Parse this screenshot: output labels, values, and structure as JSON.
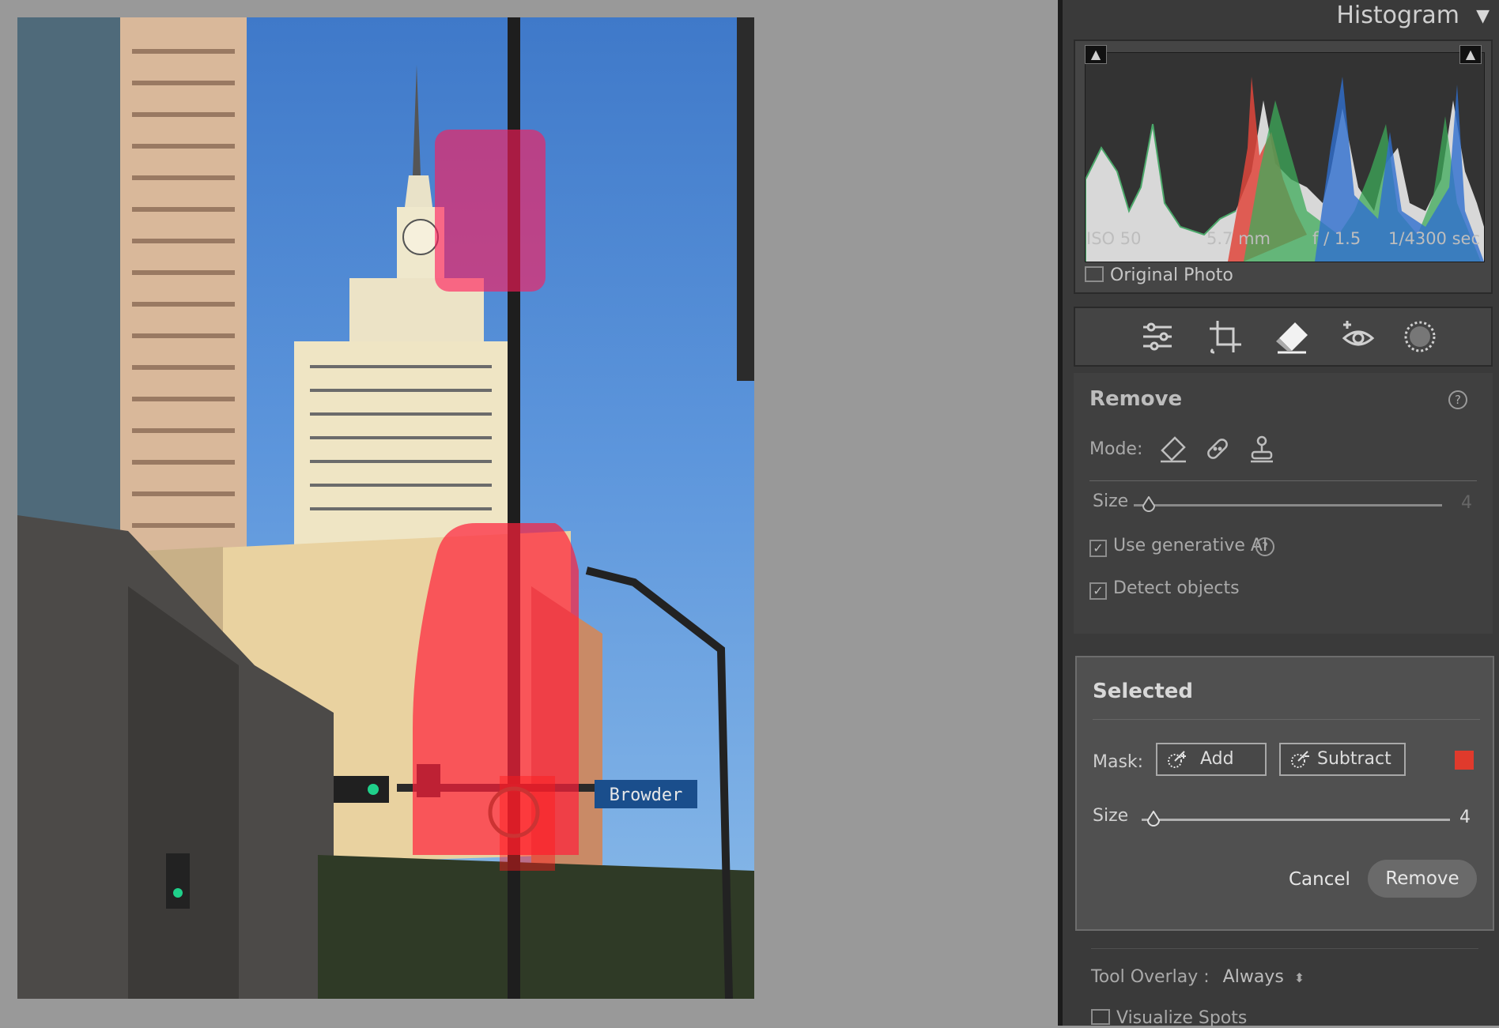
{
  "histogram": {
    "title": "Histogram",
    "menu_icon": "triangle-down-icon",
    "iso": "ISO 50",
    "focal": "5.7 mm",
    "aperture": "f / 1.5",
    "shutter": "1/4300 sec",
    "original_photo_label": "Original Photo"
  },
  "tools": [
    "edit-sliders-icon",
    "crop-icon",
    "eraser-icon",
    "red-eye-icon",
    "masking-icon"
  ],
  "remove_panel": {
    "title": "Remove",
    "mode_label": "Mode:",
    "size_label": "Size",
    "size_value": "4",
    "generative_ai_label": "Use generative AI",
    "generative_ai_checked": true,
    "detect_objects_label": "Detect objects",
    "detect_objects_checked": true
  },
  "selected_panel": {
    "title": "Selected",
    "mask_label": "Mask:",
    "add_label": "Add",
    "subtract_label": "Subtract",
    "mask_color": "#e03a2c",
    "size_label": "Size",
    "size_value": "4",
    "size_fraction": 0.06,
    "cancel_label": "Cancel",
    "remove_label": "Remove"
  },
  "tool_overlay": {
    "label": "Tool Overlay :",
    "value": "Always"
  },
  "visualize_spots_label": "Visualize Spots",
  "photo_sign_text": "Browder",
  "colors": {
    "mask_red": "#ff1a1a",
    "sky_blue": "#4d88d6",
    "panel_bg": "#3a3a3a"
  }
}
